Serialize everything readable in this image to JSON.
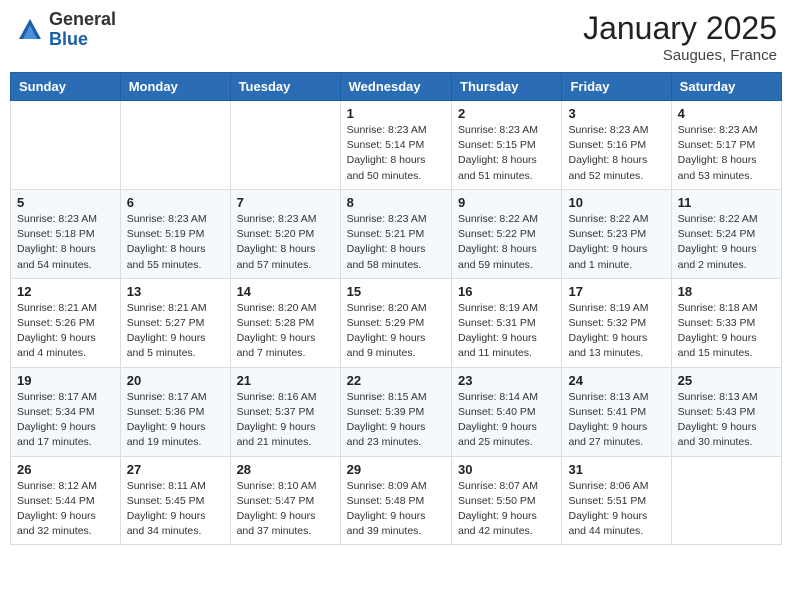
{
  "logo": {
    "general": "General",
    "blue": "Blue"
  },
  "title": "January 2025",
  "location": "Saugues, France",
  "days_of_week": [
    "Sunday",
    "Monday",
    "Tuesday",
    "Wednesday",
    "Thursday",
    "Friday",
    "Saturday"
  ],
  "weeks": [
    [
      {
        "day": "",
        "info": ""
      },
      {
        "day": "",
        "info": ""
      },
      {
        "day": "",
        "info": ""
      },
      {
        "day": "1",
        "info": "Sunrise: 8:23 AM\nSunset: 5:14 PM\nDaylight: 8 hours\nand 50 minutes."
      },
      {
        "day": "2",
        "info": "Sunrise: 8:23 AM\nSunset: 5:15 PM\nDaylight: 8 hours\nand 51 minutes."
      },
      {
        "day": "3",
        "info": "Sunrise: 8:23 AM\nSunset: 5:16 PM\nDaylight: 8 hours\nand 52 minutes."
      },
      {
        "day": "4",
        "info": "Sunrise: 8:23 AM\nSunset: 5:17 PM\nDaylight: 8 hours\nand 53 minutes."
      }
    ],
    [
      {
        "day": "5",
        "info": "Sunrise: 8:23 AM\nSunset: 5:18 PM\nDaylight: 8 hours\nand 54 minutes."
      },
      {
        "day": "6",
        "info": "Sunrise: 8:23 AM\nSunset: 5:19 PM\nDaylight: 8 hours\nand 55 minutes."
      },
      {
        "day": "7",
        "info": "Sunrise: 8:23 AM\nSunset: 5:20 PM\nDaylight: 8 hours\nand 57 minutes."
      },
      {
        "day": "8",
        "info": "Sunrise: 8:23 AM\nSunset: 5:21 PM\nDaylight: 8 hours\nand 58 minutes."
      },
      {
        "day": "9",
        "info": "Sunrise: 8:22 AM\nSunset: 5:22 PM\nDaylight: 8 hours\nand 59 minutes."
      },
      {
        "day": "10",
        "info": "Sunrise: 8:22 AM\nSunset: 5:23 PM\nDaylight: 9 hours\nand 1 minute."
      },
      {
        "day": "11",
        "info": "Sunrise: 8:22 AM\nSunset: 5:24 PM\nDaylight: 9 hours\nand 2 minutes."
      }
    ],
    [
      {
        "day": "12",
        "info": "Sunrise: 8:21 AM\nSunset: 5:26 PM\nDaylight: 9 hours\nand 4 minutes."
      },
      {
        "day": "13",
        "info": "Sunrise: 8:21 AM\nSunset: 5:27 PM\nDaylight: 9 hours\nand 5 minutes."
      },
      {
        "day": "14",
        "info": "Sunrise: 8:20 AM\nSunset: 5:28 PM\nDaylight: 9 hours\nand 7 minutes."
      },
      {
        "day": "15",
        "info": "Sunrise: 8:20 AM\nSunset: 5:29 PM\nDaylight: 9 hours\nand 9 minutes."
      },
      {
        "day": "16",
        "info": "Sunrise: 8:19 AM\nSunset: 5:31 PM\nDaylight: 9 hours\nand 11 minutes."
      },
      {
        "day": "17",
        "info": "Sunrise: 8:19 AM\nSunset: 5:32 PM\nDaylight: 9 hours\nand 13 minutes."
      },
      {
        "day": "18",
        "info": "Sunrise: 8:18 AM\nSunset: 5:33 PM\nDaylight: 9 hours\nand 15 minutes."
      }
    ],
    [
      {
        "day": "19",
        "info": "Sunrise: 8:17 AM\nSunset: 5:34 PM\nDaylight: 9 hours\nand 17 minutes."
      },
      {
        "day": "20",
        "info": "Sunrise: 8:17 AM\nSunset: 5:36 PM\nDaylight: 9 hours\nand 19 minutes."
      },
      {
        "day": "21",
        "info": "Sunrise: 8:16 AM\nSunset: 5:37 PM\nDaylight: 9 hours\nand 21 minutes."
      },
      {
        "day": "22",
        "info": "Sunrise: 8:15 AM\nSunset: 5:39 PM\nDaylight: 9 hours\nand 23 minutes."
      },
      {
        "day": "23",
        "info": "Sunrise: 8:14 AM\nSunset: 5:40 PM\nDaylight: 9 hours\nand 25 minutes."
      },
      {
        "day": "24",
        "info": "Sunrise: 8:13 AM\nSunset: 5:41 PM\nDaylight: 9 hours\nand 27 minutes."
      },
      {
        "day": "25",
        "info": "Sunrise: 8:13 AM\nSunset: 5:43 PM\nDaylight: 9 hours\nand 30 minutes."
      }
    ],
    [
      {
        "day": "26",
        "info": "Sunrise: 8:12 AM\nSunset: 5:44 PM\nDaylight: 9 hours\nand 32 minutes."
      },
      {
        "day": "27",
        "info": "Sunrise: 8:11 AM\nSunset: 5:45 PM\nDaylight: 9 hours\nand 34 minutes."
      },
      {
        "day": "28",
        "info": "Sunrise: 8:10 AM\nSunset: 5:47 PM\nDaylight: 9 hours\nand 37 minutes."
      },
      {
        "day": "29",
        "info": "Sunrise: 8:09 AM\nSunset: 5:48 PM\nDaylight: 9 hours\nand 39 minutes."
      },
      {
        "day": "30",
        "info": "Sunrise: 8:07 AM\nSunset: 5:50 PM\nDaylight: 9 hours\nand 42 minutes."
      },
      {
        "day": "31",
        "info": "Sunrise: 8:06 AM\nSunset: 5:51 PM\nDaylight: 9 hours\nand 44 minutes."
      },
      {
        "day": "",
        "info": ""
      }
    ]
  ]
}
